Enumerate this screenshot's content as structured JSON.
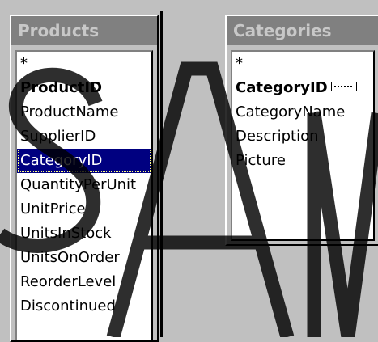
{
  "products": {
    "title": "Products",
    "fields": [
      {
        "label": "*",
        "key": false,
        "selected": false
      },
      {
        "label": "ProductID",
        "key": true,
        "selected": false
      },
      {
        "label": "ProductName",
        "key": false,
        "selected": false
      },
      {
        "label": "SupplierID",
        "key": false,
        "selected": false
      },
      {
        "label": "CategoryID",
        "key": false,
        "selected": true
      },
      {
        "label": "QuantityPerUnit",
        "key": false,
        "selected": false
      },
      {
        "label": "UnitPrice",
        "key": false,
        "selected": false
      },
      {
        "label": "UnitsInStock",
        "key": false,
        "selected": false
      },
      {
        "label": "UnitsOnOrder",
        "key": false,
        "selected": false
      },
      {
        "label": "ReorderLevel",
        "key": false,
        "selected": false
      },
      {
        "label": "Discontinued",
        "key": false,
        "selected": false
      }
    ]
  },
  "categories": {
    "title": "Categories",
    "fields": [
      {
        "label": "*",
        "key": false,
        "selected": false
      },
      {
        "label": "CategoryID",
        "key": true,
        "selected": false,
        "badge": "key-icon"
      },
      {
        "label": "CategoryName",
        "key": false,
        "selected": false
      },
      {
        "label": "Description",
        "key": false,
        "selected": false
      },
      {
        "label": "Picture",
        "key": false,
        "selected": false
      }
    ]
  },
  "watermark": {
    "text": "SAM",
    "color": "#000000"
  }
}
